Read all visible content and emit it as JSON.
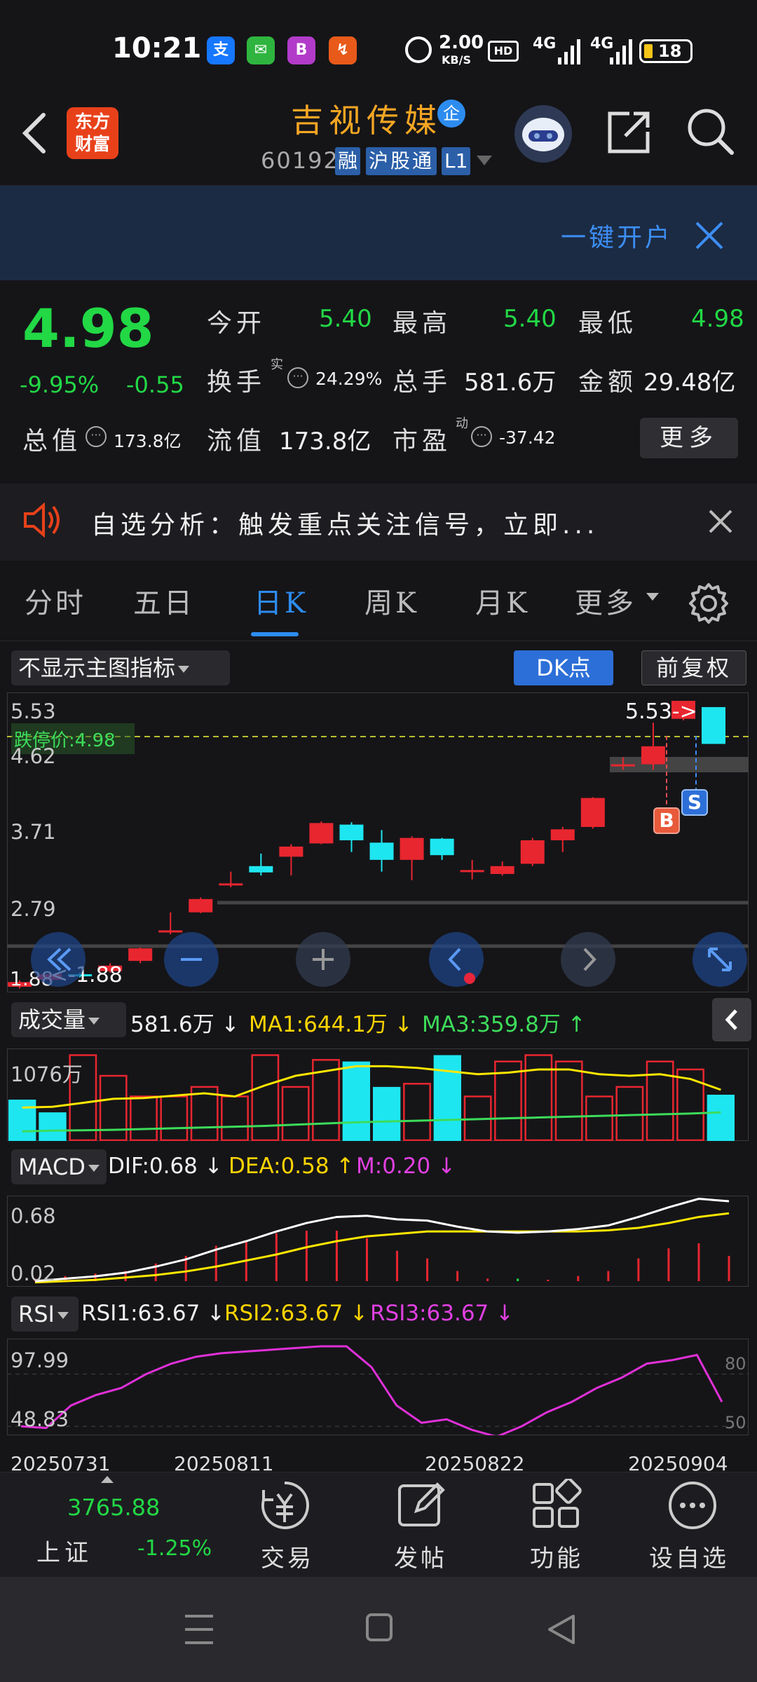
{
  "status": {
    "time": "10:21",
    "network_speed": "2.00",
    "network_unit": "KB/S",
    "signal1": "4G",
    "signal2": "4G",
    "battery": "18",
    "apps": [
      "alipay-icon",
      "chat-icon",
      "bank-icon",
      "flash-icon"
    ],
    "app_glyphs": [
      "支",
      "✉",
      "B",
      "↯"
    ]
  },
  "header": {
    "logo_line1": "东方",
    "logo_line2": "财富",
    "stock_name": "吉视传媒",
    "stock_badge": "企",
    "code": "601929",
    "tags": [
      "融",
      "沪股通",
      "L1"
    ]
  },
  "banner": {
    "text": "一键开户"
  },
  "quote": {
    "price": "4.98",
    "change_pct": "-9.95%",
    "change": "-0.55",
    "rows": [
      [
        {
          "label": "今开",
          "value": "5.40",
          "color": "green"
        },
        {
          "label": "最高",
          "value": "5.40",
          "color": "green"
        },
        {
          "label": "最低",
          "value": "4.98",
          "color": "green"
        }
      ],
      [
        {
          "label": "换手",
          "value": "24.29%",
          "color": "white"
        },
        {
          "label": "总手",
          "value": "581.6万",
          "color": "white"
        },
        {
          "label": "金额",
          "value": "29.48亿",
          "color": "white"
        }
      ]
    ],
    "turnover_sup": "实",
    "total_value_label": "总值",
    "total_value": "173.8亿",
    "float_label": "流值",
    "float_value": "173.8亿",
    "pe_label": "市盈",
    "pe_sup": "动",
    "pe_value": "-37.42",
    "more": "更多"
  },
  "notice": {
    "text": "自选分析：触发重点关注信号，立即..."
  },
  "tabs": [
    "分时",
    "五日",
    "日K",
    "周K",
    "月K",
    "更多"
  ],
  "active_tab": "日K",
  "chart_toolbar": {
    "indicator_select": "不显示主图指标",
    "dk_button": "DK点",
    "adjust_button": "前复权"
  },
  "kline": {
    "y_labels": [
      "5.53",
      "4.62",
      "3.71",
      "2.79",
      "1.88"
    ],
    "limit_label": "跌停价:4.98",
    "max_label": "5.53->",
    "min_label": "<-1.88",
    "buy_marker": "B",
    "sell_marker": "S"
  },
  "volume": {
    "select": "成交量",
    "value": "581.6万 ↓",
    "ma1": "MA1:644.1万 ↓",
    "ma3": "MA3:359.8万 ↑",
    "y_label": "1076万"
  },
  "macd": {
    "select": "MACD",
    "dif": "DIF:0.68 ↓",
    "dea": "DEA:0.58 ↑",
    "m": "M:0.20 ↓",
    "y_top": "0.68",
    "y_bottom": "0.02"
  },
  "rsi": {
    "select": "RSI",
    "rsi1": "RSI1:63.67 ↓",
    "rsi2": "RSI2:63.67 ↓",
    "rsi3": "RSI3:63.67 ↓",
    "y_top": "97.99",
    "y_bottom": "48.83",
    "y_right_top": "80",
    "y_right_bottom": "50"
  },
  "dates": [
    "20250731",
    "20250811",
    "20250822",
    "20250904"
  ],
  "bottom": {
    "index_value": "3765.88",
    "index_name": "上证",
    "index_change": "-1.25%",
    "trade": "交易",
    "post": "发帖",
    "function": "功能",
    "watch": "设自选"
  },
  "chart_data": {
    "type": "candlestick",
    "candles": [
      {
        "o": 1.88,
        "c": 1.94,
        "h": 1.96,
        "l": 1.86
      },
      {
        "o": 1.97,
        "c": 2.04,
        "h": 2.06,
        "l": 1.95
      },
      {
        "o": 2.04,
        "c": 2.02,
        "h": 2.06,
        "l": 2.0
      },
      {
        "o": 2.08,
        "c": 2.15,
        "h": 2.18,
        "l": 2.06
      },
      {
        "o": 2.21,
        "c": 2.37,
        "h": 2.38,
        "l": 2.18
      },
      {
        "o": 2.6,
        "c": 2.6,
        "h": 2.83,
        "l": 2.55
      },
      {
        "o": 2.83,
        "c": 3.0,
        "h": 3.02,
        "l": 2.82
      },
      {
        "o": 3.2,
        "c": 3.2,
        "h": 3.35,
        "l": 3.15
      },
      {
        "o": 3.42,
        "c": 3.34,
        "h": 3.58,
        "l": 3.3
      },
      {
        "o": 3.54,
        "c": 3.67,
        "h": 3.7,
        "l": 3.3
      },
      {
        "o": 3.71,
        "c": 3.97,
        "h": 3.99,
        "l": 3.7
      },
      {
        "o": 3.95,
        "c": 3.75,
        "h": 3.98,
        "l": 3.6
      },
      {
        "o": 3.72,
        "c": 3.5,
        "h": 3.88,
        "l": 3.35
      },
      {
        "o": 3.5,
        "c": 3.78,
        "h": 3.8,
        "l": 3.24
      },
      {
        "o": 3.77,
        "c": 3.56,
        "h": 3.78,
        "l": 3.5
      },
      {
        "o": 3.37,
        "c": 3.37,
        "h": 3.5,
        "l": 3.25
      },
      {
        "o": 3.32,
        "c": 3.42,
        "h": 3.48,
        "l": 3.3
      },
      {
        "o": 3.45,
        "c": 3.75,
        "h": 3.78,
        "l": 3.42
      },
      {
        "o": 3.75,
        "c": 3.89,
        "h": 3.92,
        "l": 3.6
      },
      {
        "o": 3.92,
        "c": 4.29,
        "h": 4.3,
        "l": 3.9
      },
      {
        "o": 4.72,
        "c": 4.72,
        "h": 4.81,
        "l": 4.65
      },
      {
        "o": 4.72,
        "c": 4.95,
        "h": 5.25,
        "l": 4.65
      },
      {
        "o": 5.3,
        "c": 5.53,
        "h": 5.53,
        "l": 5.28
      },
      {
        "o": 5.45,
        "c": 4.98,
        "h": 5.45,
        "l": 4.98
      }
    ],
    "candle_up": [
      true,
      true,
      false,
      true,
      true,
      true,
      true,
      true,
      false,
      true,
      true,
      false,
      false,
      true,
      false,
      true,
      true,
      true,
      true,
      true,
      true,
      true,
      true,
      false
    ],
    "volume": [
      520,
      360,
      1080,
      820,
      560,
      560,
      680,
      560,
      1080,
      680,
      1020,
      1000,
      680,
      720,
      1080,
      560,
      1000,
      1080,
      1000,
      560,
      680,
      1000,
      900,
      582
    ],
    "volume_up": [
      false,
      false,
      true,
      true,
      true,
      true,
      true,
      true,
      true,
      true,
      true,
      false,
      false,
      true,
      false,
      true,
      true,
      true,
      true,
      true,
      true,
      true,
      true,
      false
    ],
    "ma1": [
      420,
      430,
      480,
      530,
      540,
      570,
      600,
      560,
      700,
      820,
      880,
      940,
      940,
      920,
      880,
      840,
      860,
      900,
      900,
      840,
      820,
      840,
      780,
      644
    ],
    "ma3": [
      120,
      130,
      135,
      140,
      150,
      160,
      170,
      180,
      190,
      205,
      220,
      235,
      245,
      255,
      265,
      275,
      285,
      295,
      305,
      315,
      325,
      335,
      345,
      360
    ],
    "dif": [
      0.02,
      0.04,
      0.06,
      0.09,
      0.14,
      0.2,
      0.28,
      0.35,
      0.43,
      0.5,
      0.55,
      0.56,
      0.53,
      0.52,
      0.47,
      0.43,
      0.42,
      0.43,
      0.45,
      0.48,
      0.55,
      0.63,
      0.7,
      0.68
    ],
    "dea": [
      0.01,
      0.02,
      0.03,
      0.05,
      0.07,
      0.1,
      0.14,
      0.19,
      0.24,
      0.3,
      0.35,
      0.39,
      0.41,
      0.43,
      0.43,
      0.43,
      0.43,
      0.43,
      0.43,
      0.44,
      0.46,
      0.5,
      0.55,
      0.58
    ],
    "macd_m": [
      0.02,
      0.04,
      0.06,
      0.08,
      0.14,
      0.2,
      0.28,
      0.32,
      0.38,
      0.4,
      0.4,
      0.34,
      0.24,
      0.18,
      0.08,
      0.02,
      -0.02,
      0.0,
      0.04,
      0.08,
      0.18,
      0.26,
      0.3,
      0.2
    ],
    "rsi": [
      50,
      49,
      62,
      68,
      72,
      80,
      86,
      90,
      92,
      93,
      94,
      95,
      96,
      96,
      84,
      62,
      52,
      54,
      48,
      44,
      50,
      58,
      64,
      72,
      78,
      86,
      88,
      91,
      64
    ],
    "price_range": [
      1.88,
      5.53
    ],
    "volume_max": 1076,
    "macd_range": [
      0.02,
      0.68
    ],
    "rsi_range": [
      48.83,
      97.99
    ]
  }
}
